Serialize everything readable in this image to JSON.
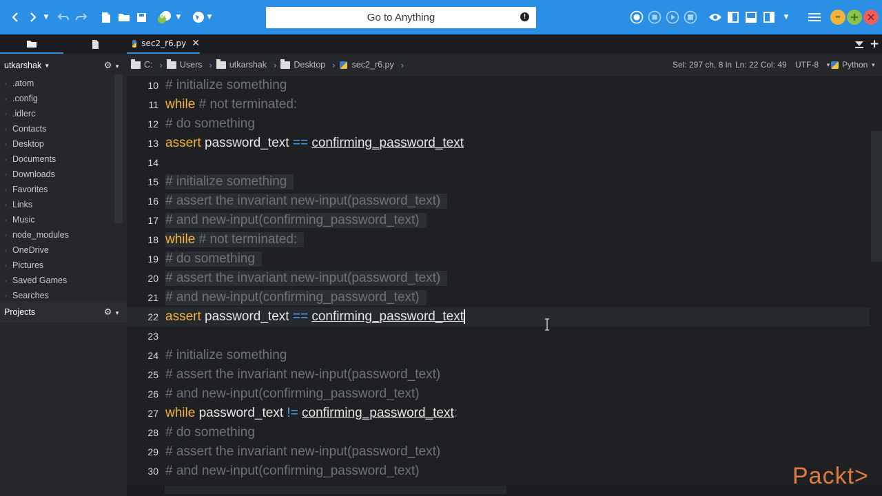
{
  "toolbar": {
    "goto_label": "Go to Anything",
    "goto_badge": "!",
    "badge_count": "0"
  },
  "tabs": {
    "file_tab": "sec2_r6.py"
  },
  "sidebar": {
    "user": "utkarshak",
    "items": [
      ".atom",
      ".config",
      ".idlerc",
      "Contacts",
      "Desktop",
      "Documents",
      "Downloads",
      "Favorites",
      "Links",
      "Music",
      "node_modules",
      "OneDrive",
      "Pictures",
      "Saved Games",
      "Searches"
    ],
    "projects_label": "Projects"
  },
  "breadcrumb": {
    "c": "C:",
    "users": "Users",
    "user": "utkarshak",
    "desktop": "Desktop",
    "file": "sec2_r6.py"
  },
  "status": {
    "selection": "Sel: 297 ch, 8 ln",
    "position": "Ln: 22 Col: 49",
    "encoding": "UTF-8",
    "language": "Python"
  },
  "code_lines": [
    {
      "n": "10",
      "t": "# initialize something"
    },
    {
      "n": "11",
      "t": "while # not terminated:"
    },
    {
      "n": "12",
      "t": "# do something"
    },
    {
      "n": "13",
      "t": "assert password_text == confirming_password_text"
    },
    {
      "n": "14",
      "t": ""
    },
    {
      "n": "15",
      "t": "# initialize something"
    },
    {
      "n": "16",
      "t": "# assert the invariant new-input(password_text)"
    },
    {
      "n": "17",
      "t": "# and new-input(confirming_password_text)"
    },
    {
      "n": "18",
      "t": "while # not terminated:"
    },
    {
      "n": "19",
      "t": "# do something"
    },
    {
      "n": "20",
      "t": "# assert the invariant new-input(password_text)"
    },
    {
      "n": "21",
      "t": "# and new-input(confirming_password_text)"
    },
    {
      "n": "22",
      "t": "assert password_text == confirming_password_text"
    },
    {
      "n": "23",
      "t": ""
    },
    {
      "n": "24",
      "t": "# initialize something"
    },
    {
      "n": "25",
      "t": "# assert the invariant new-input(password_text)"
    },
    {
      "n": "26",
      "t": "# and new-input(confirming_password_text)"
    },
    {
      "n": "27",
      "t": "while password_text != confirming_password_text:"
    },
    {
      "n": "28",
      "t": "# do something"
    },
    {
      "n": "29",
      "t": "# assert the invariant new-input(password_text)"
    },
    {
      "n": "30",
      "t": "# and new-input(confirming_password_text)"
    }
  ],
  "watermark": "Packt>",
  "colors": {
    "toolbar": "#2b8fe6",
    "keyword": "#f2b33d",
    "comment": "#6e7378",
    "operator": "#4aa3f0",
    "watermark": "#e07a3e"
  }
}
